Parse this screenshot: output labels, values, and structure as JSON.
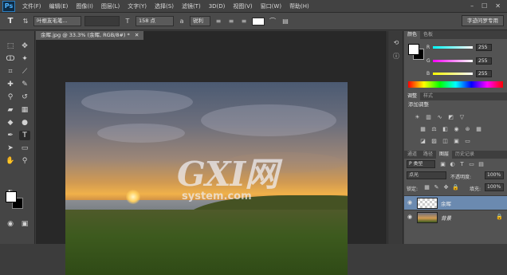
{
  "app": {
    "logo": "Ps"
  },
  "menu": [
    "文件(F)",
    "编辑(E)",
    "图像(I)",
    "图层(L)",
    "文字(Y)",
    "选择(S)",
    "滤镜(T)",
    "3D(D)",
    "视图(V)",
    "窗口(W)",
    "帮助(H)"
  ],
  "window_controls": [
    "–",
    "☐",
    "✕"
  ],
  "options": {
    "tool_glyph": "T",
    "font_family": "叶根友毛笔...",
    "font_style": "",
    "font_size": "158 点",
    "aa_label": "a",
    "aa_value": "锐利",
    "workspace": "字迹问罗专用"
  },
  "document": {
    "tab": "余晖.jpg @ 33.3% (余晖, RGB/8#) *",
    "close": "✕"
  },
  "watermark": {
    "text": "GXI网",
    "sub": "system.com"
  },
  "panels": {
    "color_tabs": [
      "颜色",
      "色板"
    ],
    "color": {
      "r_label": "R",
      "g_label": "G",
      "b_label": "B",
      "r": "255",
      "g": "255",
      "b": "255"
    },
    "adj_tabs": [
      "调整",
      "样式"
    ],
    "adj_title": "添加调整",
    "layer_tabs": [
      "通道",
      "路径",
      "图层",
      "历史记录"
    ],
    "layers": {
      "filter": "P 类型",
      "blend": "点光",
      "opacity_label": "不透明度:",
      "opacity": "100%",
      "lock_label": "锁定:",
      "fill_label": "填充:",
      "fill": "100%",
      "items": [
        {
          "name": "余晖",
          "selected": true
        },
        {
          "name": "背景",
          "selected": false
        }
      ]
    }
  },
  "colors": {
    "accent": "#6b8ab0",
    "bg": "#3c3c3c",
    "panel": "#535353"
  }
}
